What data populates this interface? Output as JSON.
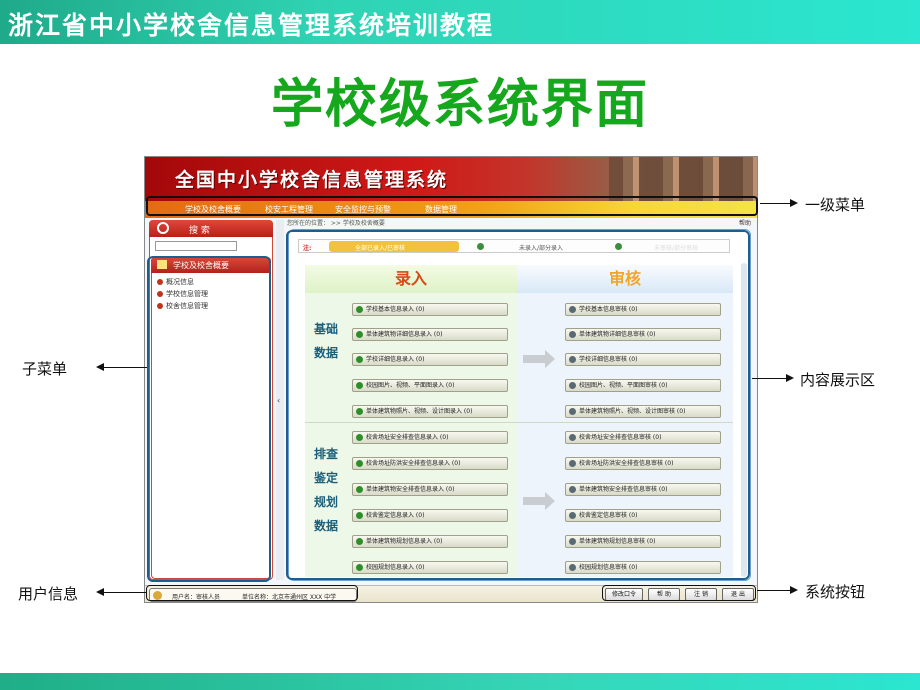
{
  "slide": {
    "top_title": "浙江省中小学校舍信息管理系统培训教程",
    "title": "学校级系统界面"
  },
  "app": {
    "banner_title": "全国中小学校舍信息管理系统",
    "menu": [
      "学校及校舍概要",
      "校安工程管理",
      "安全监控与预警",
      "数据管理"
    ],
    "search_label": "搜 索",
    "submenu_title": "学校及校舍概要",
    "submenu_items": [
      "概况信息",
      "学校信息管理",
      "校舍信息管理"
    ],
    "breadcrumb": "您所在的位置：  >> 学校及校舍概要",
    "help": "帮助",
    "legend": {
      "prefix": "注:",
      "items": [
        "全部已录入/已审核",
        "未录入/部分录入",
        "未审核/部分审核"
      ]
    },
    "entry_header": "录入",
    "audit_header": "审核",
    "sections": [
      "基础数据",
      "排查鉴定规划数据"
    ],
    "entry_buttons": [
      "学校基本信息录入 (0)",
      "单体建筑物详细信息录入 (0)",
      "学校详细信息录入 (0)",
      "校园图片、视频、平面图录入 (0)",
      "单体建筑物照片、视频、设计图录入 (0)",
      "校舍场址安全排查信息录入 (0)",
      "校舍场址防洪安全排查信息录入 (0)",
      "单体建筑物安全排查信息录入 (0)",
      "校舍鉴定信息录入 (0)",
      "单体建筑物规划信息录入 (0)",
      "校园规划信息录入 (0)"
    ],
    "audit_buttons": [
      "学校基本信息审核 (0)",
      "单体建筑物详细信息审核 (0)",
      "学校详细信息审核 (0)",
      "校园图片、视频、平面图审核 (0)",
      "单体建筑物照片、视频、设计图审核 (0)",
      "校舍场址安全排查信息审核 (0)",
      "校舍场址防洪安全排查信息审核 (0)",
      "单体建筑物安全排查信息审核 (0)",
      "校舍鉴定信息审核 (0)",
      "单体建筑物规划信息审核 (0)",
      "校园规划信息审核 (0)"
    ],
    "user": {
      "name_label": "用户名：审核人员",
      "unit_label": "单位名称：北京市通州区 XXX 中学"
    },
    "system_buttons": [
      "修改口令",
      "帮 助",
      "注 销",
      "退 出"
    ]
  },
  "callouts": {
    "menu": "一级菜单",
    "submenu": "子菜单",
    "content": "内容展示区",
    "user": "用户信息",
    "system": "系统按钮"
  },
  "colors": {
    "title_green": "#15a81c",
    "band_teal": "#2fd3b3",
    "app_red": "#c01a18",
    "menu_orange": "#f2a01a"
  }
}
